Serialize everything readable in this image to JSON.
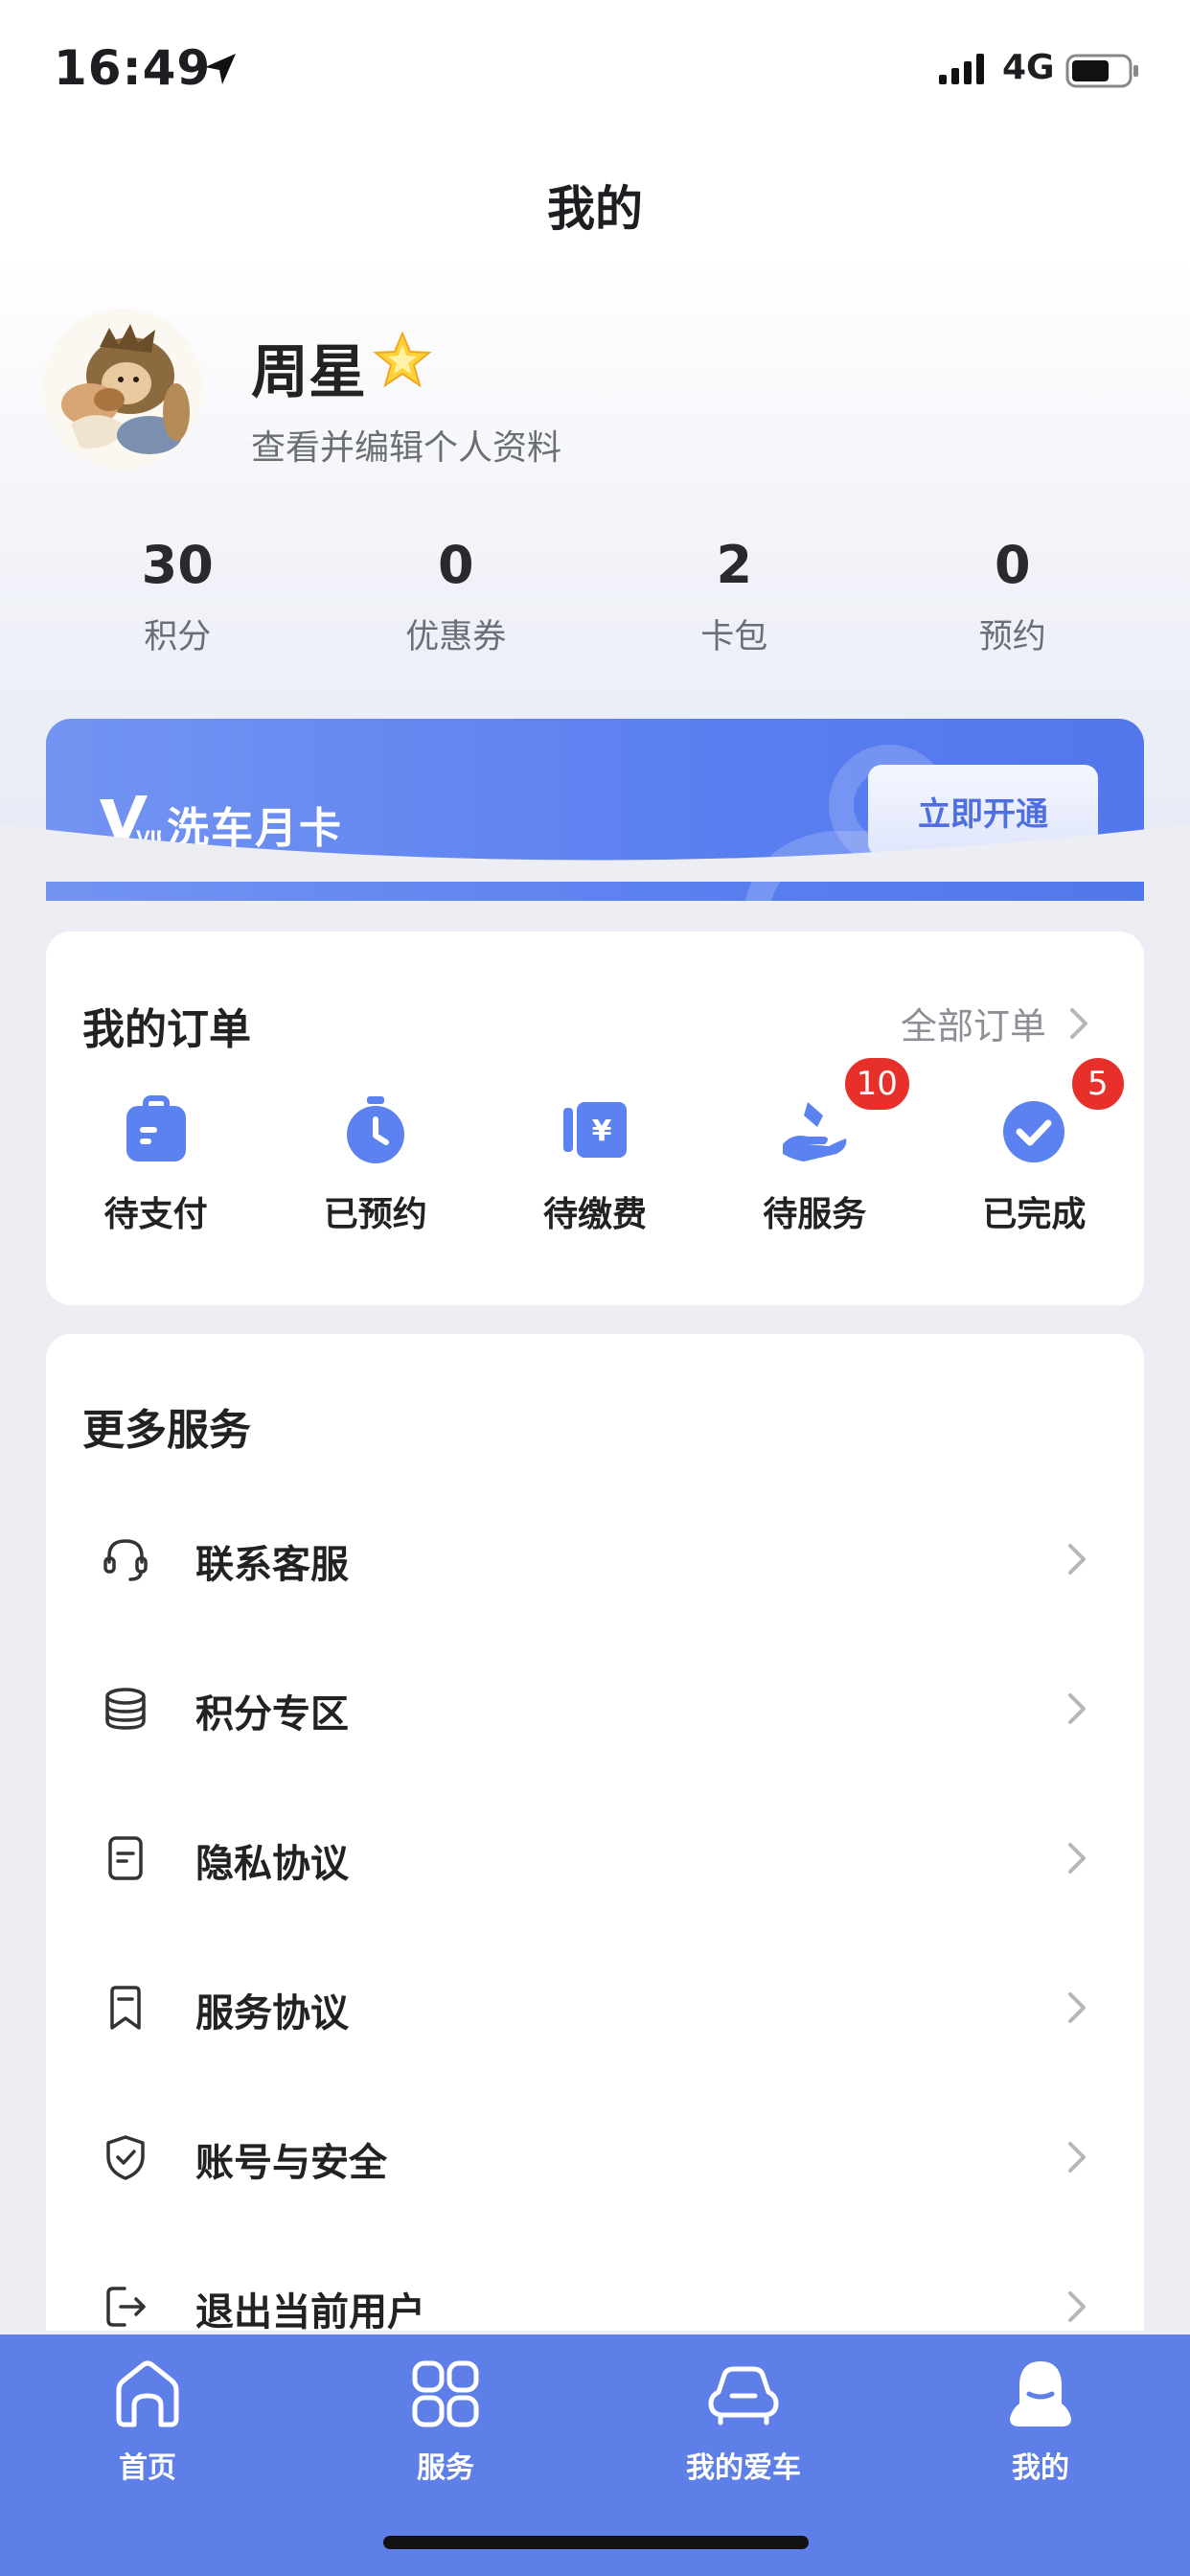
{
  "status_bar": {
    "time": "16:49",
    "network": "4G"
  },
  "header": {
    "title": "我的"
  },
  "profile": {
    "name": "周星",
    "edit_link": "查看并编辑个人资料"
  },
  "stats": [
    {
      "value": "30",
      "label": "积分"
    },
    {
      "value": "0",
      "label": "优惠券"
    },
    {
      "value": "2",
      "label": "卡包"
    },
    {
      "value": "0",
      "label": "预约"
    }
  ],
  "vip": {
    "title": "洗车月卡",
    "button": "立即开通",
    "logo_text": "VIP"
  },
  "orders": {
    "title": "我的订单",
    "all_link": "全部订单",
    "items": [
      {
        "label": "待支付",
        "icon": "wallet-icon",
        "badge": ""
      },
      {
        "label": "已预约",
        "icon": "stopwatch-icon",
        "badge": ""
      },
      {
        "label": "待缴费",
        "icon": "bill-icon",
        "badge": ""
      },
      {
        "label": "待服务",
        "icon": "hand-service-icon",
        "badge": "10"
      },
      {
        "label": "已完成",
        "icon": "check-circle-icon",
        "badge": "5"
      }
    ]
  },
  "services": {
    "title": "更多服务",
    "items": [
      {
        "label": "联系客服",
        "icon": "headset-icon"
      },
      {
        "label": "积分专区",
        "icon": "coins-icon"
      },
      {
        "label": "隐私协议",
        "icon": "document-icon"
      },
      {
        "label": "服务协议",
        "icon": "bookmark-icon"
      },
      {
        "label": "账号与安全",
        "icon": "shield-icon"
      },
      {
        "label": "退出当前用户",
        "icon": "logout-icon"
      }
    ]
  },
  "tabs": [
    {
      "label": "首页",
      "icon": "home-icon"
    },
    {
      "label": "服务",
      "icon": "grid-icon"
    },
    {
      "label": "我的爱车",
      "icon": "car-icon"
    },
    {
      "label": "我的",
      "icon": "profile-icon",
      "active": true
    }
  ],
  "colors": {
    "accent": "#5f7fe8",
    "badge": "#e8302b",
    "order_icon": "#5b82f0"
  }
}
